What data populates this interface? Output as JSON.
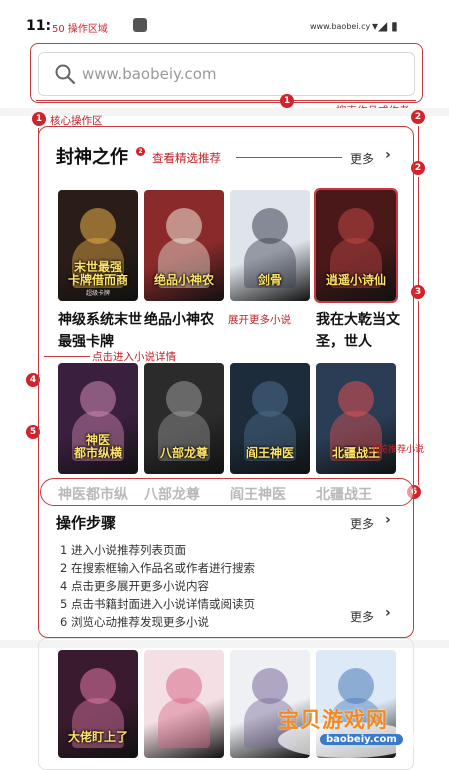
{
  "status_bar": {
    "time": "11:",
    "note": "50 操作区域",
    "url": "www.baobei.cy",
    "icons": "▾◢ ▮"
  },
  "search": {
    "placeholder": "www.baobeiy.com"
  },
  "annotations": {
    "badge_1": "1",
    "badge_2": "2",
    "badge_3": "3",
    "badge_4": "4",
    "badge_5": "5",
    "badge_6": "6",
    "search_hint": "搜索作品或作者",
    "core_area": "核心操作区",
    "see_picks": "查看精选推荐",
    "expand_more": "展开更多小说",
    "enter_detail": "点击进入小说详情",
    "browse_recommend": "浏览推荐小说",
    "small_dot": "2"
  },
  "section": {
    "title": "封神之作",
    "more_label": "更多"
  },
  "books_row1": [
    {
      "cover_title": "末世最强\n卡牌借而商",
      "subtitle": "超级卡牌",
      "name": "神级系统末世最强卡牌",
      "bg": "#2a1d18",
      "fg": "#e8b04a"
    },
    {
      "cover_title": "绝品小神农",
      "subtitle": "",
      "name": "绝品小神农",
      "bg": "#8b2a2a",
      "fg": "#f0e6d8"
    },
    {
      "cover_title": "剑骨",
      "subtitle": "",
      "name": "",
      "bg": "#dfe4ea",
      "fg": "#3b4050"
    },
    {
      "cover_title": "逍遥小诗仙",
      "subtitle": "",
      "name": "我在大乾当文圣，世人",
      "bg": "#4a1818",
      "fg": "#c04848"
    }
  ],
  "books_row2": [
    {
      "cover_title": "神医\n都市纵横",
      "subtitle": "",
      "name": "神医都市纵",
      "bg": "#3a1f3e",
      "fg": "#d28ab4"
    },
    {
      "cover_title": "八部龙尊",
      "subtitle": "",
      "name": "八部龙尊",
      "bg": "#2b2b2b",
      "fg": "#9a9a9a"
    },
    {
      "cover_title": "阎王神医",
      "subtitle": "",
      "name": "阎王神医",
      "bg": "#1c2c3a",
      "fg": "#4e6e8e"
    },
    {
      "cover_title": "北疆战王",
      "subtitle": "",
      "name": "北疆战王",
      "bg": "#2a3d55",
      "fg": "#e05050"
    }
  ],
  "steps": {
    "title": "操作步骤",
    "more_label": "更多",
    "more_label_2": "更多",
    "items": [
      "1 进入小说推荐列表页面",
      "2 在搜索框输入作品名或作者进行搜索",
      "4 点击更多展开更多小说内容",
      "5 点击书籍封面进入小说详情或阅读页",
      "6 浏览心动推荐发现更多小说"
    ]
  },
  "books_row3": [
    {
      "cover_title": "大佬盯上了",
      "bg": "#3a1a2e",
      "fg": "#e07aa8"
    },
    {
      "cover_title": "",
      "bg": "#f3dfe4",
      "fg": "#d86a88"
    },
    {
      "cover_title": "",
      "bg": "#eef0f4",
      "fg": "#7a6a9a"
    },
    {
      "cover_title": "",
      "bg": "#dde9f6",
      "fg": "#4a7ab8"
    }
  ],
  "watermark": {
    "text": "宝贝游戏网",
    "url": "baobeiy.com"
  },
  "colors": {
    "accent": "#d2232a",
    "frame": "#c73a40",
    "watermark": "#f28a1f"
  }
}
